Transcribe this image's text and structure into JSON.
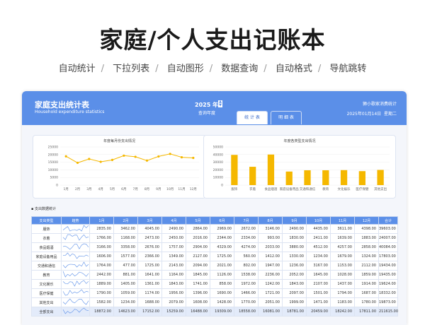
{
  "hero": {
    "title": "家庭/个人支出记账本"
  },
  "features": [
    "自动统计",
    "下拉列表",
    "自动图形",
    "数据查询",
    "自动格式",
    "导航跳转"
  ],
  "header": {
    "title": "家庭支出统计表",
    "subtitle": "Household expenditure statistics",
    "year": "2025 年",
    "year_hint": "查询年度",
    "right_top": "狮小歌家消费统计",
    "date": "2025年01月14日",
    "weekday": "星期二",
    "tabs": [
      "统 计 表",
      "明 细 表"
    ]
  },
  "colors": {
    "accent": "#5b8fe8",
    "line": "#f5b800",
    "bar": "#f5b800"
  },
  "line_chart": {
    "title": "年度每月份支出情况"
  },
  "bar_chart": {
    "title": "年度各类型支出情况"
  },
  "table_label": "支出数据统计",
  "table": {
    "headers": [
      "支出类型",
      "趋势",
      "1月",
      "2月",
      "3月",
      "4月",
      "5月",
      "6月",
      "7月",
      "8月",
      "9月",
      "10月",
      "11月",
      "12月",
      "合计"
    ],
    "rows": [
      {
        "cat": "服饰",
        "values": [
          "2835.00",
          "3462.00",
          "4045.00",
          "2490.00",
          "2864.00",
          "2969.00",
          "2672.00",
          "3146.00",
          "2490.00",
          "4435.00",
          "3611.00",
          "4398.00",
          "39603.00"
        ]
      },
      {
        "cat": "衣着",
        "values": [
          "1766.00",
          "1168.00",
          "2473.00",
          "2450.00",
          "2016.00",
          "2344.00",
          "2334.00",
          "993.00",
          "1830.00",
          "2411.00",
          "1639.00",
          "1883.00",
          "24007.00"
        ]
      },
      {
        "cat": "食品烟酒",
        "values": [
          "3166.00",
          "3358.00",
          "2676.00",
          "1757.00",
          "2904.00",
          "4329.00",
          "4274.00",
          "2033.00",
          "3880.00",
          "4512.00",
          "4257.00",
          "2858.00",
          "40084.00"
        ]
      },
      {
        "cat": "家庭设备用品",
        "values": [
          "1606.00",
          "1577.00",
          "2366.00",
          "1349.00",
          "2127.00",
          "1725.00",
          "560.00",
          "1412.00",
          "1330.00",
          "1234.00",
          "1679.00",
          "1324.00",
          "17803.00"
        ]
      },
      {
        "cat": "交通和通信",
        "values": [
          "1764.00",
          "477.00",
          "1725.00",
          "2143.00",
          "2094.00",
          "2021.00",
          "802.00",
          "1947.00",
          "1236.00",
          "3167.00",
          "1153.00",
          "2112.00",
          "19434.00"
        ]
      },
      {
        "cat": "教育",
        "values": [
          "2442.00",
          "881.00",
          "1641.00",
          "1164.00",
          "1845.00",
          "1126.00",
          "1538.00",
          "2236.00",
          "2052.00",
          "1645.00",
          "1028.00",
          "1859.00",
          "19435.00"
        ]
      },
      {
        "cat": "文化娱乐",
        "values": [
          "1889.00",
          "1405.00",
          "1361.00",
          "1843.00",
          "1741.00",
          "858.00",
          "1972.00",
          "1242.00",
          "1843.00",
          "2107.00",
          "1437.00",
          "1914.00",
          "19624.00"
        ]
      },
      {
        "cat": "医疗保健",
        "values": [
          "1790.00",
          "1059.00",
          "1174.00",
          "1956.00",
          "1396.00",
          "1690.00",
          "1466.00",
          "1721.00",
          "2097.00",
          "1501.00",
          "1794.00",
          "1687.00",
          "18332.00"
        ]
      },
      {
        "cat": "其他支出",
        "values": [
          "1582.00",
          "1234.00",
          "1688.00",
          "2079.00",
          "1608.00",
          "1428.00",
          "1770.00",
          "2051.00",
          "1999.00",
          "1471.00",
          "1183.00",
          "1780.00",
          "19873.00"
        ]
      },
      {
        "cat": "全部支出",
        "values": [
          "18872.00",
          "14623.00",
          "17152.00",
          "15259.00",
          "16488.00",
          "19309.00",
          "18558.00",
          "16081.00",
          "18781.00",
          "20459.00",
          "18242.00",
          "17811.00",
          "211615.00"
        ]
      }
    ]
  },
  "chart_data": [
    {
      "type": "line",
      "title": "年度每月份支出情况",
      "x": [
        "1月",
        "2月",
        "3月",
        "4月",
        "5月",
        "6月",
        "7月",
        "8月",
        "9月",
        "10月",
        "11月",
        "12月"
      ],
      "series": [
        {
          "values": [
            18872,
            14623,
            17152,
            15259,
            16488,
            19309,
            18558,
            16081,
            18781,
            20459,
            18242,
            17811
          ]
        }
      ],
      "yticks": [
        "25000",
        "20000",
        "15000",
        "10000",
        "5000",
        "0"
      ],
      "ylim": [
        0,
        25000
      ]
    },
    {
      "type": "bar",
      "title": "年度各类型支出情况",
      "categories": [
        "服饰",
        "衣着",
        "食品烟酒",
        "家庭设备用品",
        "交通和通信",
        "教育",
        "文化娱乐",
        "医疗保健",
        "其他支出"
      ],
      "values": [
        39603,
        24007,
        40084,
        17803,
        19434,
        19435,
        19624,
        18332,
        19873
      ],
      "yticks": [
        "50000",
        "40000",
        "30000",
        "20000",
        "10000",
        "0"
      ],
      "ylim": [
        0,
        50000
      ]
    }
  ]
}
